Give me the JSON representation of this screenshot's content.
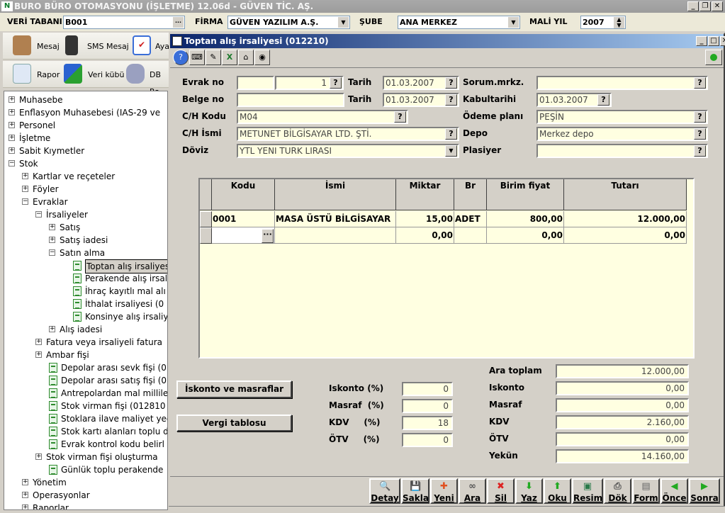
{
  "app": {
    "title": "BURO BÜRO OTOMASYONU (İŞLETME) 12.06d - GÜVEN TİC. AŞ."
  },
  "topbar": {
    "db_label": "VERİ TABANI",
    "db_value": "B001",
    "firm_label": "FİRMA",
    "firm_value": "GÜVEN YAZILIM  A.Ş.",
    "branch_label": "ŞUBE",
    "branch_value": "ANA MERKEZ",
    "year_label": "MALİ YIL",
    "year_value": "2007"
  },
  "toolbar1": [
    "Mesaj",
    "SMS Mesaj",
    "Aya"
  ],
  "toolbar2": [
    "Rapor",
    "Veri kübü",
    "DB Ra"
  ],
  "tree": [
    {
      "t": "Muhasebe",
      "l": 0,
      "k": "+"
    },
    {
      "t": "Enflasyon Muhasebesi (IAS-29 ve",
      "l": 0,
      "k": "+"
    },
    {
      "t": "Personel",
      "l": 0,
      "k": "+"
    },
    {
      "t": "İşletme",
      "l": 0,
      "k": "+"
    },
    {
      "t": "Sabit Kıymetler",
      "l": 0,
      "k": "+"
    },
    {
      "t": "Stok",
      "l": 0,
      "k": "-"
    },
    {
      "t": "Kartlar ve reçeteler",
      "l": 1,
      "k": "+"
    },
    {
      "t": "Föyler",
      "l": 1,
      "k": "+"
    },
    {
      "t": "Evraklar",
      "l": 1,
      "k": "-"
    },
    {
      "t": "İrsaliyeler",
      "l": 2,
      "k": "-"
    },
    {
      "t": "Satış",
      "l": 3,
      "k": "+"
    },
    {
      "t": "Satış iadesi",
      "l": 3,
      "k": "+"
    },
    {
      "t": "Satın alma",
      "l": 3,
      "k": "-"
    },
    {
      "t": "Toptan alış irsaliyes",
      "l": 4,
      "k": "d",
      "sel": true
    },
    {
      "t": "Perakende alış irsal",
      "l": 4,
      "k": "d"
    },
    {
      "t": "İhraç kayıtlı mal alı",
      "l": 4,
      "k": "d"
    },
    {
      "t": "İthalat irsaliyesi (0",
      "l": 4,
      "k": "d"
    },
    {
      "t": "Konsinye alış irsaliy",
      "l": 4,
      "k": "d"
    },
    {
      "t": "Alış iadesi",
      "l": 3,
      "k": "+"
    },
    {
      "t": "Fatura veya irsaliyeli fatura",
      "l": 2,
      "k": "+"
    },
    {
      "t": "Ambar fişi",
      "l": 2,
      "k": "+"
    },
    {
      "t": "Depolar arası sevk fişi (01",
      "l": 3,
      "k": "d"
    },
    {
      "t": "Depolar arası satış fişi (01",
      "l": 3,
      "k": "d"
    },
    {
      "t": "Antrepolardan mal millile",
      "l": 3,
      "k": "d"
    },
    {
      "t": "Stok virman fişi (012810",
      "l": 3,
      "k": "d"
    },
    {
      "t": "Stoklara ilave maliyet yed",
      "l": 3,
      "k": "d"
    },
    {
      "t": "Stok kartı alanları toplu d",
      "l": 3,
      "k": "d"
    },
    {
      "t": "Evrak kontrol kodu belirl",
      "l": 3,
      "k": "d"
    },
    {
      "t": "Stok virman fişi oluşturma",
      "l": 2,
      "k": "+"
    },
    {
      "t": "Günlük toplu perakende",
      "l": 3,
      "k": "d"
    },
    {
      "t": "Yönetim",
      "l": 1,
      "k": "+"
    },
    {
      "t": "Operasyonlar",
      "l": 1,
      "k": "+"
    },
    {
      "t": "Raporlar",
      "l": 1,
      "k": "+"
    }
  ],
  "child": {
    "title": "Toptan alış irsaliyesi (012210)",
    "status_color": "#22aa22"
  },
  "form": {
    "evrak_no_label": "Evrak no",
    "evrak_serial": "",
    "evrak_no": "1",
    "tarih_label": "Tarih",
    "tarih": "01.03.2007",
    "belge_no_label": "Belge no",
    "belge_no": "",
    "tarih2_label": "Tarih",
    "tarih2": "01.03.2007",
    "ch_kodu_label": "C/H Kodu",
    "ch_kodu": "M04",
    "ch_ismi_label": "C/H İsmi",
    "ch_ismi": "METUNET BİLGİSAYAR LTD. ŞTİ.",
    "doviz_label": "Döviz",
    "doviz": "YTL YENI TURK LIRASI",
    "sorum_label": "Sorum.mrkz.",
    "sorum": "",
    "kabul_label": "Kabultarihi",
    "kabul": "01.03.2007",
    "odeme_label": "Ödeme planı",
    "odeme": "PEŞİN",
    "depo_label": "Depo",
    "depo": "Merkez depo",
    "plasiyer_label": "Plasiyer",
    "plasiyer": "",
    "q": "?"
  },
  "grid": {
    "columns": [
      "Kodu",
      "İsmi",
      "Miktar",
      "Br",
      "Birim fiyat",
      "Tutarı"
    ],
    "rows": [
      [
        "0001",
        "MASA ÜSTÜ BİLGİSAYAR",
        "15,00",
        "ADET",
        "800,00",
        "12.000,00"
      ],
      [
        "",
        "",
        "0,00",
        "",
        "0,00",
        "0,00"
      ]
    ]
  },
  "discount": {
    "btn_iskonto": "İskonto ve masraflar",
    "btn_vergi": "Vergi tablosu",
    "rates": [
      {
        "label": "Iskonto (%)",
        "value": "0"
      },
      {
        "label": "Masraf  (%)",
        "value": "0"
      },
      {
        "label": "KDV     (%)",
        "value": "18"
      },
      {
        "label": "ÖTV     (%)",
        "value": "0"
      }
    ]
  },
  "totals": [
    {
      "label": "Ara toplam",
      "value": "12.000,00"
    },
    {
      "label": "Iskonto",
      "value": "0,00"
    },
    {
      "label": "Masraf",
      "value": "0,00"
    },
    {
      "label": "KDV",
      "value": "2.160,00"
    },
    {
      "label": "ÖTV",
      "value": "0,00"
    },
    {
      "label": "Yekün",
      "value": "14.160,00"
    }
  ],
  "actions": [
    {
      "label": "Detay",
      "icon": "magnifier-icon",
      "g": "🔍",
      "c": "#3366cc"
    },
    {
      "label": "Sakla",
      "icon": "floppy-disk-icon",
      "g": "💾",
      "c": "#223399"
    },
    {
      "label": "Yeni",
      "icon": "new-document-icon",
      "g": "✚",
      "c": "#e05020"
    },
    {
      "label": "Ara",
      "icon": "binoculars-icon",
      "g": "∞",
      "c": "#555"
    },
    {
      "label": "Sil",
      "icon": "delete-x-icon",
      "g": "✖",
      "c": "#dd2222"
    },
    {
      "label": "Yaz",
      "icon": "write-down-arrow-icon",
      "g": "⬇",
      "c": "#22aa22"
    },
    {
      "label": "Oku",
      "icon": "read-up-arrow-icon",
      "g": "⬆",
      "c": "#22aa22"
    },
    {
      "label": "Resim",
      "icon": "picture-icon",
      "g": "▣",
      "c": "#2a7a4a"
    },
    {
      "label": "Dök",
      "icon": "printer-icon",
      "g": "⎙",
      "c": "#555"
    },
    {
      "label": "Form",
      "icon": "form-icon",
      "g": "▤",
      "c": "#666"
    },
    {
      "label": "Önce",
      "icon": "previous-arrow-icon",
      "g": "◀",
      "c": "#22aa22"
    },
    {
      "label": "Sonra",
      "icon": "next-arrow-icon",
      "g": "▶",
      "c": "#22aa22"
    }
  ]
}
